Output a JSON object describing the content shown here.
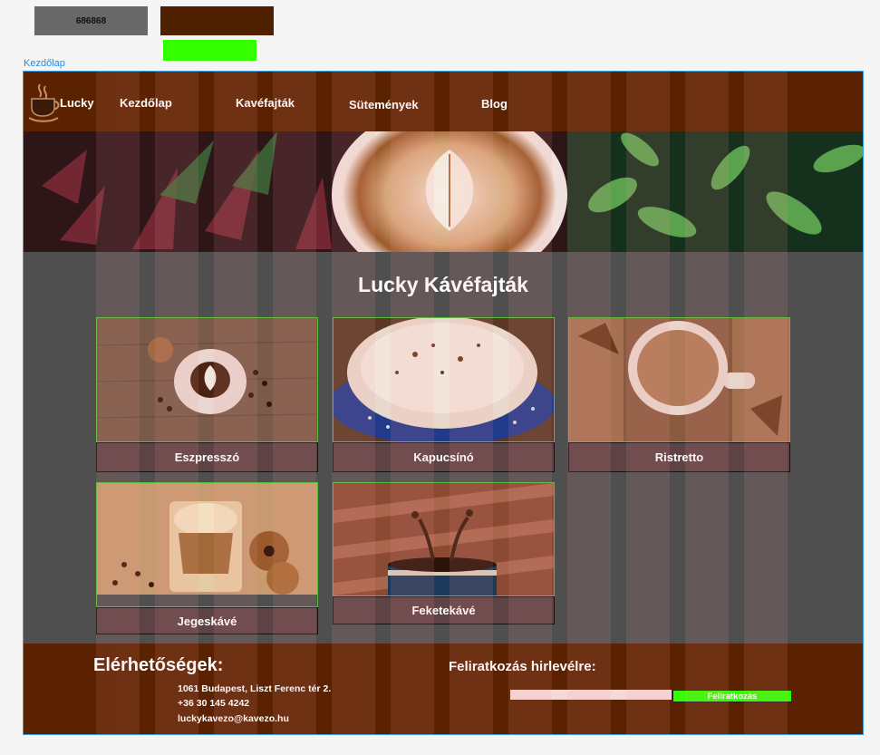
{
  "swatches": {
    "grey_label": "686868",
    "grey_color": "#686868",
    "brown_color": "#4e2000",
    "green_color": "#33ff00"
  },
  "frame": {
    "label": "Kezdőlap"
  },
  "nav": {
    "brand": "Lucky",
    "links": [
      "Kezdőlap",
      "Kavéfajták",
      "Sütemények",
      "Blog"
    ]
  },
  "section": {
    "title": "Lucky Kávéfajták"
  },
  "cards": [
    {
      "label": "Eszpresszó"
    },
    {
      "label": "Kapucsínó"
    },
    {
      "label": "Ristretto"
    },
    {
      "label": "Jegeskávé"
    },
    {
      "label": "Feketekávé"
    }
  ],
  "footer": {
    "title": "Elérhetőségek:",
    "address": "1061 Budapest, Liszt Ferenc tér 2.",
    "phone": "+36 30 145 4242",
    "email": "luckykavezo@kavezo.hu",
    "newsletter_title": "Feliratkozás hirlevélre:",
    "subscribe_label": "Feliratkozás",
    "input_value": ""
  },
  "colors": {
    "nav_bg": "#5a2200",
    "page_bg": "#4f4f4f",
    "accent_green": "#33ff00",
    "card_label_bg": "#5d4346"
  },
  "icons": [
    "coffee-cup-logo-icon"
  ]
}
